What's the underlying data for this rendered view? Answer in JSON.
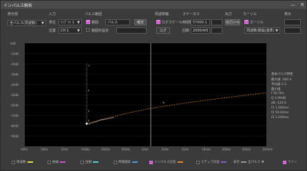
{
  "window": {
    "title": "インパルス解析",
    "min": "—",
    "close": "✕"
  },
  "controls": {
    "group1_label": "表示部",
    "group1_value": "全パルス(周波数)",
    "group2_label": "入力",
    "ch_label": "単位",
    "ch_value": "ｲﾝﾌﾟｯﾄ 1",
    "ch2_label": "位置",
    "ch2_value": "CH 1",
    "group3_label": "パルス範囲",
    "mark_label": "範囲",
    "mark_field": "パルス",
    "confirm_btn": "確定",
    "limit_label": "範囲外設定",
    "group4_label": "周波数軸",
    "logscale_label": "ログスケール",
    "logscale_btn": "ログ",
    "group5_label": "ステータス",
    "freq_label": "時間軸",
    "freq_value": "57000.1",
    "count_label": "回数",
    "count_value": "2000/4/0",
    "group6_label": "出力",
    "output_btn": "出力ﾌｧｲﾙ",
    "group7_label": "カーソル",
    "cursor_label": "カーソル",
    "cursor_value": "周波数/振幅(基準)",
    "group8_label": "表示"
  },
  "plot": {
    "y_ticks": [
      "0dB",
      "-10dB",
      "-20dB",
      "-30dB",
      "-40dB",
      "-50dB",
      "-60dB",
      "-70dB",
      "-80dB",
      "-90dB"
    ],
    "x_ticks": [
      "10Hz",
      "20Hz",
      "50Hz",
      "100Hz",
      "200Hz",
      "500Hz",
      "1kHz",
      "2kHz",
      "5kHz",
      "10kHz",
      "20kHz",
      "50kHz",
      "100kHz"
    ]
  },
  "info": {
    "header": "基本パルス特性",
    "rows": [
      "最大値   -360.4",
      "平均値   2.5",
      "最小値",
      "f   50.7Hz",
      "Q   1.99dB",
      "dB   -120.0",
      "f1   1.000ms",
      "f2   50.00ms",
      "f3   1.000ms"
    ]
  },
  "legend": [
    "周波数",
    "振幅",
    "位相",
    "時間遅延",
    "群遅延",
    "インパルス応答",
    "ステップ応答",
    "周波数特性"
  ],
  "legend_right": {
    "label": "表示",
    "value": "全パルス",
    "check_label": "ライン"
  }
}
